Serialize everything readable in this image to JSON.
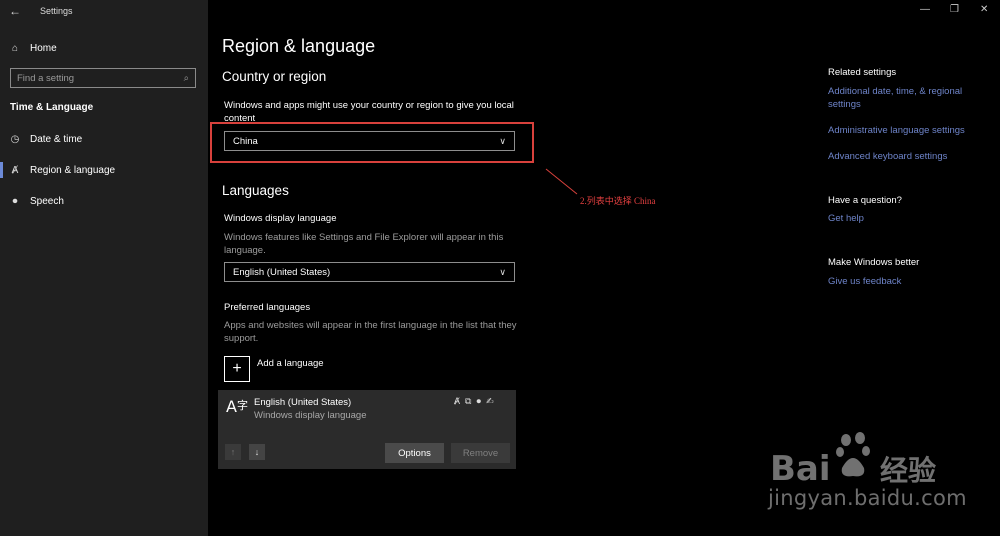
{
  "window": {
    "title": "Settings",
    "controls": [
      "—",
      "❐",
      "✕"
    ]
  },
  "sidebar": {
    "home": "Home",
    "search_placeholder": "Find a setting",
    "section": "Time & Language",
    "items": [
      {
        "label": "Date & time",
        "icon": "clock-icon"
      },
      {
        "label": "Region & language",
        "icon": "region-language-icon",
        "active": true
      },
      {
        "label": "Speech",
        "icon": "microphone-icon"
      }
    ]
  },
  "main": {
    "title": "Region & language",
    "country": {
      "heading": "Country or region",
      "description": "Windows and apps might use your country or region to give you local content",
      "value": "China"
    },
    "languages": {
      "heading": "Languages",
      "display_label": "Windows display language",
      "display_desc": "Windows features like Settings and File Explorer will appear in this language.",
      "display_value": "English (United States)",
      "preferred_label": "Preferred languages",
      "preferred_desc": "Apps and websites will appear in the first language in the list that they support.",
      "add_label": "Add a language",
      "entry_name": "English (United States)",
      "entry_sub": "Windows display language",
      "options_label": "Options",
      "remove_label": "Remove"
    }
  },
  "right": {
    "related_title": "Related settings",
    "links": [
      "Additional date, time, & regional settings",
      "Administrative language settings",
      "Advanced keyboard settings"
    ],
    "question_title": "Have a question?",
    "help_link": "Get help",
    "better_title": "Make Windows better",
    "feedback_link": "Give us feedback"
  },
  "annotation": {
    "text": "2.列表中选择 China",
    "color": "#e44040"
  },
  "watermark": {
    "brand": "Bai",
    "brand2": "经验",
    "url": "jingyan.baidu.com"
  }
}
